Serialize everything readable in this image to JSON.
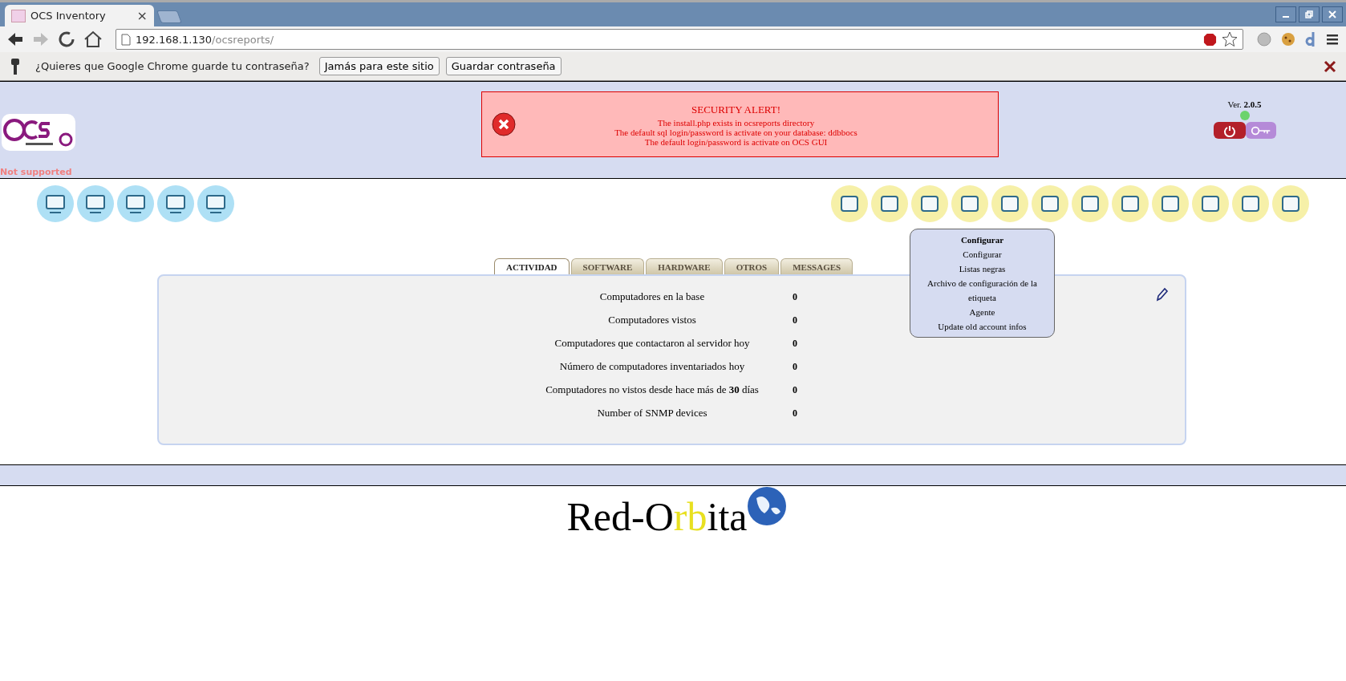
{
  "browser": {
    "tab_title": "OCS Inventory",
    "tab_close": "×",
    "url_host": "192.168.1.130",
    "url_path": "/ocsreports/"
  },
  "password_bar": {
    "message": "¿Quieres que Google Chrome guarde tu contraseña?",
    "buttons": [
      "Jamás para este sitio",
      "Guardar contraseña"
    ]
  },
  "header": {
    "notice": "Not supported",
    "alert": {
      "title": "SECURITY ALERT!",
      "lines": [
        "The install.php exists in ocsreports directory",
        "The default sql login/password is activate on your database: ddbbocs",
        "The default login/password is activate on OCS GUI"
      ]
    },
    "version": "Ver. **2.0.5**"
  },
  "menu_popup": {
    "title": "Configurar",
    "items": [
      "Configurar",
      "Listas negras",
      "Archivo de configuración de la etiqueta",
      "Agente",
      "Update old account infos"
    ]
  },
  "tabs": [
    {
      "label": "ACTIVIDAD",
      "selected": true
    },
    {
      "label": "SOFTWARE",
      "selected": false
    },
    {
      "label": "HARDWARE",
      "selected": false
    },
    {
      "label": "OTROS",
      "selected": false
    },
    {
      "label": "MESSAGES",
      "selected": false
    }
  ],
  "stats": [
    {
      "label": "Computadores en la base",
      "value": "0"
    },
    {
      "label": "Computadores vistos",
      "value": "0"
    },
    {
      "label": "Computadores que contactaron al servidor hoy",
      "value": "0"
    },
    {
      "label": "Número de computadores inventariados hoy",
      "value": "0"
    },
    {
      "label": "Computadores no vistos desde hace más de **30** días",
      "value": "0"
    },
    {
      "label": "Number of SNMP devices",
      "value": "0"
    }
  ],
  "footer_logo": [
    {
      "text": "Red-O",
      "highlight": false
    },
    {
      "text": "rb",
      "highlight": true
    },
    {
      "text": "ita",
      "highlight": false
    }
  ]
}
